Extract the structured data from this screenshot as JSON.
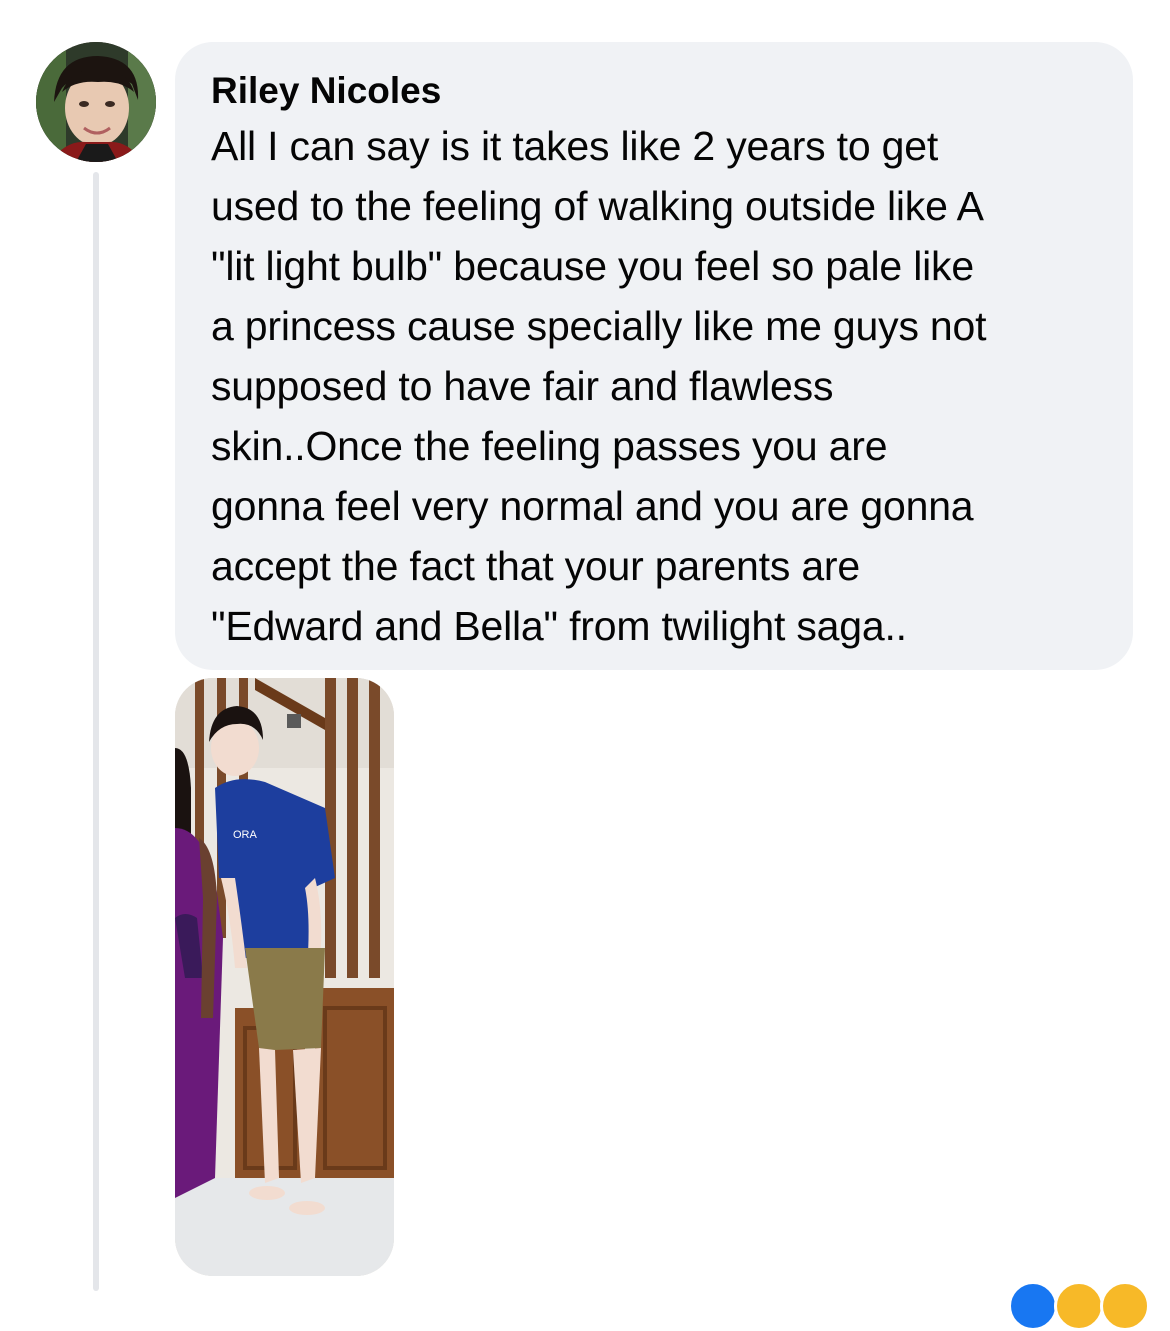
{
  "comment": {
    "author": "Riley Nicoles",
    "text": "All I can say is it takes like 2 years to get\nused to the feeling of walking outside like A\n\"lit light bulb\" because you feel so pale like\na princess cause specially like me guys not\nsupposed to have fair and flawless\nskin..Once the feeling passes you are\ngonna feel very normal and you are gonna\naccept the fact that your parents are\n\"Edward and Bella\" from twilight saga..",
    "avatar_icon": "profile-photo-avatar",
    "attachment_icon": "photo-attachment"
  },
  "reactions": {
    "icons": [
      "like-reaction-icon",
      "haha-reaction-icon",
      "wow-reaction-icon"
    ],
    "colors": [
      "#1877f2",
      "#f7b928",
      "#f7b928"
    ]
  },
  "colors": {
    "bubble_bg": "#f0f2f5",
    "text": "#050505",
    "thread_line": "#e4e6ea"
  }
}
